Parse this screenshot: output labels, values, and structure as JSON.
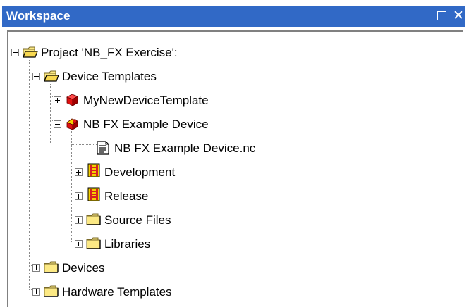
{
  "window": {
    "title": "Workspace",
    "maximize_icon": "maximize-icon",
    "close_glyph": "✕"
  },
  "tree": {
    "project": "Project 'NB_FX Exercise':",
    "device_templates": "Device Templates",
    "my_new_device_template": "MyNewDeviceTemplate",
    "nb_fx_example_device": "NB FX Example Device",
    "nb_fx_example_device_nc": "NB FX Example Device.nc",
    "development": "Development",
    "release": "Release",
    "source_files": "Source Files",
    "libraries": "Libraries",
    "devices": "Devices",
    "hardware_templates": "Hardware Templates"
  },
  "colors": {
    "titlebar": "#3169c6",
    "folder": "#fce984",
    "folder_edge": "#b8a24a",
    "device_red": "#e01010",
    "config_red": "#d62020",
    "config_yellow": "#f4d000"
  }
}
